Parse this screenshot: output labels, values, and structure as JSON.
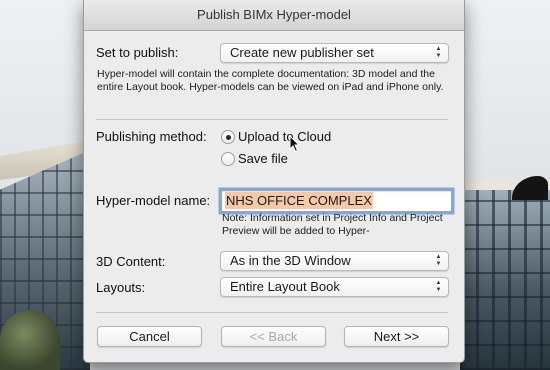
{
  "window": {
    "title": "Publish BIMx Hyper-model"
  },
  "publish_set": {
    "label": "Set to publish:",
    "selected": "Create new publisher set"
  },
  "description": "Hyper-model will contain the complete documentation: 3D model and the entire Layout book. Hyper-models can be viewed on iPad and iPhone only.",
  "publishing_method": {
    "label": "Publishing method:",
    "options": [
      {
        "label": "Upload to Cloud",
        "selected": true
      },
      {
        "label": "Save file",
        "selected": false
      }
    ]
  },
  "hyper_model_name": {
    "label": "Hyper-model name:",
    "value": "NHS OFFICE COMPLEX",
    "note": "Note: Information set in Project Info and Project Preview will be added to Hyper-"
  },
  "content_3d": {
    "label": "3D Content:",
    "selected": "As in the 3D Window"
  },
  "layouts": {
    "label": "Layouts:",
    "selected": "Entire Layout Book"
  },
  "buttons": {
    "cancel": "Cancel",
    "back": "<< Back",
    "next": "Next >>"
  },
  "icons": {
    "popup_arrows": "updown-arrows-icon",
    "cursor": "mouse-pointer-icon"
  },
  "colors": {
    "selection_highlight": "#f6c9a6",
    "focus_ring": "#7fa9de"
  }
}
